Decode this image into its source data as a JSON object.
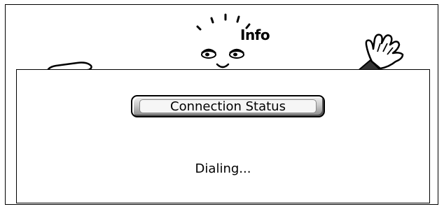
{
  "dialog": {
    "header_label": "Info",
    "status_button_label": "Connection Status",
    "status_message": "Dialing..."
  },
  "icons": {
    "face": "cartoon-face-icon",
    "left_hand": "pointing-hand-icon",
    "right_hand": "waving-hand-icon"
  }
}
